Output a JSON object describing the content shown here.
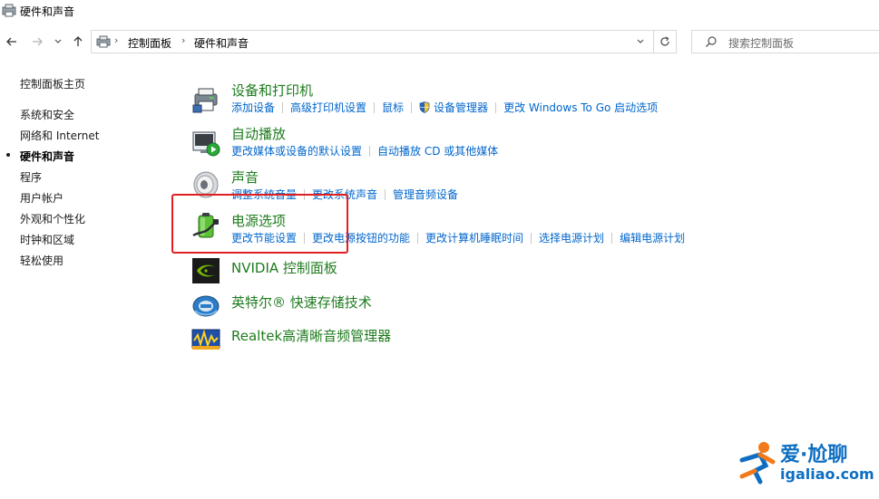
{
  "window": {
    "title": "硬件和声音"
  },
  "address": {
    "crumbs": [
      "控制面板",
      "硬件和声音"
    ]
  },
  "search": {
    "placeholder": "搜索控制面板"
  },
  "sidebar": {
    "items": [
      {
        "label": "控制面板主页"
      },
      {
        "label": "系统和安全"
      },
      {
        "label": "网络和 Internet"
      },
      {
        "label": "硬件和声音",
        "current": true
      },
      {
        "label": "程序"
      },
      {
        "label": "用户帐户"
      },
      {
        "label": "外观和个性化"
      },
      {
        "label": "时钟和区域"
      },
      {
        "label": "轻松使用"
      }
    ]
  },
  "categories": [
    {
      "title": "设备和打印机",
      "icon": "printer-icon",
      "links": [
        "添加设备",
        "高级打印机设置",
        "鼠标",
        "设备管理器",
        "更改 Windows To Go 启动选项"
      ]
    },
    {
      "title": "自动播放",
      "icon": "autoplay-icon",
      "links": [
        "更改媒体或设备的默认设置",
        "自动播放 CD 或其他媒体"
      ]
    },
    {
      "title": "声音",
      "icon": "speaker-icon",
      "links": [
        "调整系统音量",
        "更改系统声音",
        "管理音频设备"
      ]
    },
    {
      "title": "电源选项",
      "icon": "battery-icon",
      "links": [
        "更改节能设置",
        "更改电源按钮的功能",
        "更改计算机睡眠时间",
        "选择电源计划",
        "编辑电源计划"
      ]
    },
    {
      "title": "NVIDIA 控制面板",
      "icon": "nvidia-icon",
      "links": []
    },
    {
      "title": "英特尔® 快速存储技术",
      "icon": "intel-rst-icon",
      "links": []
    },
    {
      "title": "Realtek高清晰音频管理器",
      "icon": "realtek-audio-icon",
      "links": []
    }
  ],
  "watermark": {
    "line1": "爱·尬聊",
    "line2": "igaliao.com"
  },
  "colors": {
    "category_title": "#1e7b1e",
    "link": "#0066cc",
    "highlight": "#e02020"
  }
}
